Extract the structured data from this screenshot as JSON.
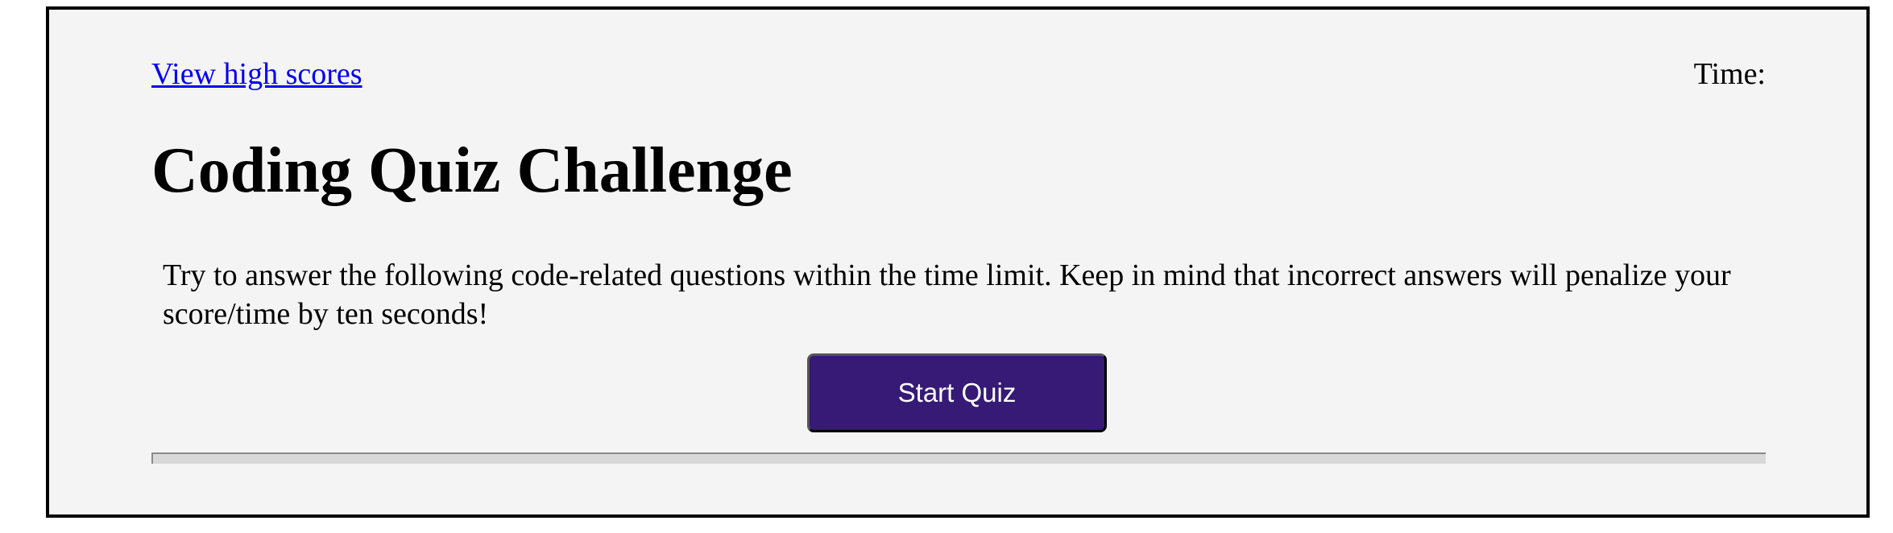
{
  "header": {
    "high_scores_link": "View high scores",
    "timer_label": "Time:"
  },
  "main": {
    "title": "Coding Quiz Challenge",
    "description": "Try to answer the following code-related questions within the time limit. Keep in mind that incorrect answers will penalize your score/time by ten seconds!",
    "start_button_label": "Start Quiz"
  },
  "colors": {
    "background": "#f4f4f4",
    "button_bg": "#361a75",
    "link": "#0000ee"
  }
}
